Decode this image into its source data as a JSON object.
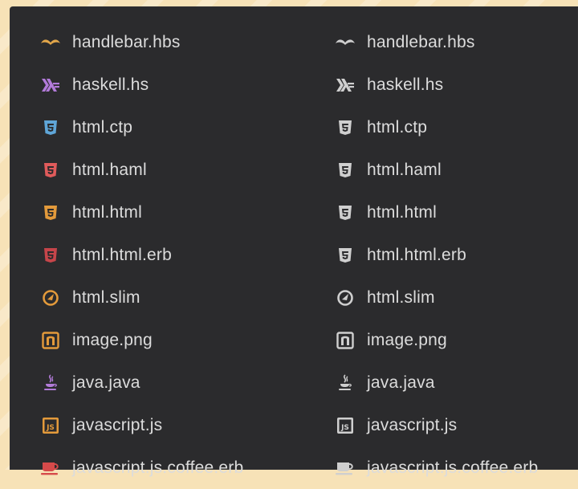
{
  "colors": {
    "background": "#f7e2b7",
    "panel": "#2b2b2d",
    "text": "#dcdcdc",
    "monochrome_icon": "#cfcfcf"
  },
  "left_column": {
    "items": [
      {
        "label": "handlebar.hbs",
        "icon": "handlebars-mustache-icon",
        "color": "#e2a64a"
      },
      {
        "label": "haskell.hs",
        "icon": "haskell-icon",
        "color": "#b27bd9"
      },
      {
        "label": "html.ctp",
        "icon": "html5-shield-icon",
        "color": "#5fa6d8"
      },
      {
        "label": "html.haml",
        "icon": "html5-shield-icon",
        "color": "#e05b5b"
      },
      {
        "label": "html.html",
        "icon": "html5-shield-icon",
        "color": "#e39a3b"
      },
      {
        "label": "html.html.erb",
        "icon": "html5-shield-icon",
        "color": "#c6454a"
      },
      {
        "label": "html.slim",
        "icon": "slim-gauge-icon",
        "color": "#e39a3b"
      },
      {
        "label": "image.png",
        "icon": "image-frame-icon",
        "color": "#e39a3b"
      },
      {
        "label": "java.java",
        "icon": "java-cup-icon",
        "color": "#b27bd9"
      },
      {
        "label": "javascript.js",
        "icon": "javascript-box-icon",
        "color": "#e39a3b"
      },
      {
        "label": "javascript.js.coffee.erb",
        "icon": "coffee-cup-icon",
        "color": "#d64a4a"
      }
    ]
  },
  "right_column": {
    "items": [
      {
        "label": "handlebar.hbs",
        "icon": "handlebars-mustache-icon"
      },
      {
        "label": "haskell.hs",
        "icon": "haskell-icon"
      },
      {
        "label": "html.ctp",
        "icon": "html5-shield-icon"
      },
      {
        "label": "html.haml",
        "icon": "html5-shield-icon"
      },
      {
        "label": "html.html",
        "icon": "html5-shield-icon"
      },
      {
        "label": "html.html.erb",
        "icon": "html5-shield-icon"
      },
      {
        "label": "html.slim",
        "icon": "slim-gauge-icon"
      },
      {
        "label": "image.png",
        "icon": "image-frame-icon"
      },
      {
        "label": "java.java",
        "icon": "java-cup-icon"
      },
      {
        "label": "javascript.js",
        "icon": "javascript-box-icon"
      },
      {
        "label": "javascript.js.coffee.erb",
        "icon": "coffee-cup-icon"
      }
    ]
  },
  "glyphs": {
    "js_text": "JS"
  }
}
